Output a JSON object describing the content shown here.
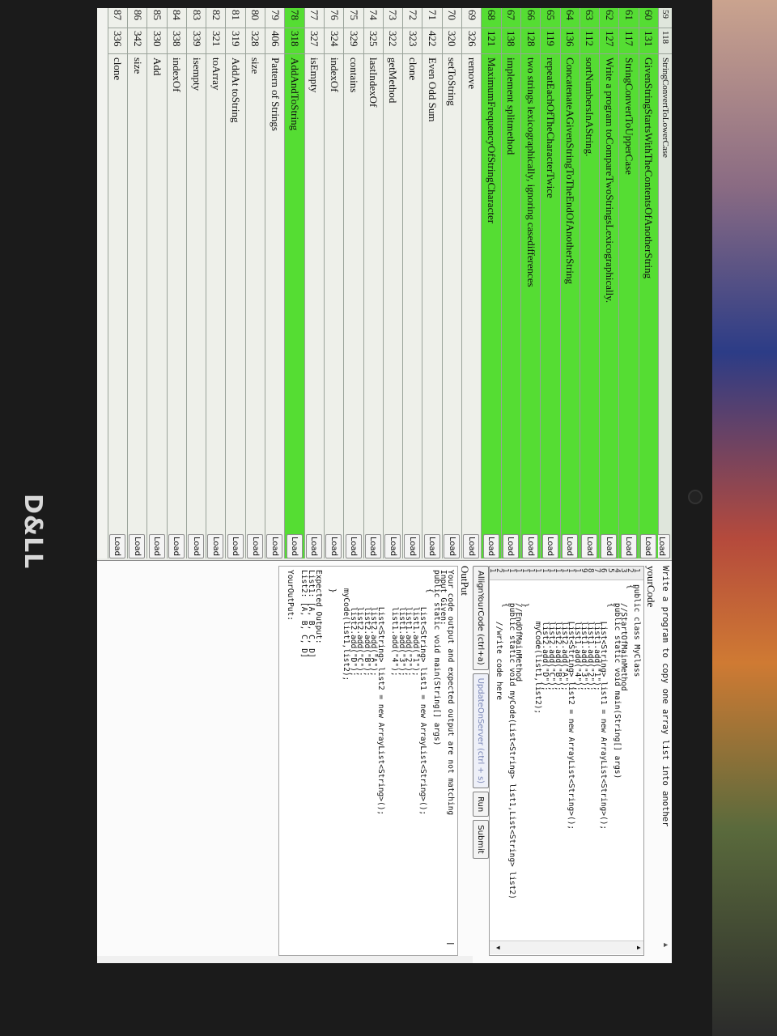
{
  "device": {
    "brand": "D&LL"
  },
  "problems": {
    "header_partial": "StringConvertToLowerCase",
    "header_no": "59",
    "header_id": "118",
    "load_label": "Load",
    "rows": [
      {
        "no": "60",
        "id": "131",
        "name": "GivenStringStartsWithTheContentsOfAnotherString",
        "status": "done"
      },
      {
        "no": "61",
        "id": "117",
        "name": "StringConvertToUpperCase",
        "status": "done"
      },
      {
        "no": "62",
        "id": "127",
        "name": "Write a program toCompareTwoStringsLexicographically.",
        "status": "done"
      },
      {
        "no": "63",
        "id": "112",
        "name": "sortNumbersInAString.",
        "status": "done"
      },
      {
        "no": "64",
        "id": "136",
        "name": "ConcatenateAGivenStringToTheEndOfAnotherString",
        "status": "done"
      },
      {
        "no": "65",
        "id": "119",
        "name": "repeatEachOfTheCharacterTwice",
        "status": "done"
      },
      {
        "no": "66",
        "id": "128",
        "name": "two strings lexicographically, ignoring casedifferences",
        "status": "done"
      },
      {
        "no": "67",
        "id": "138",
        "name": "implement splitmethod",
        "status": "done"
      },
      {
        "no": "68",
        "id": "121",
        "name": "MaximumFrequencyOfStringCharacter",
        "status": "done"
      },
      {
        "no": "69",
        "id": "326",
        "name": "remove",
        "status": "plain"
      },
      {
        "no": "70",
        "id": "320",
        "name": "setToString",
        "status": "plain"
      },
      {
        "no": "71",
        "id": "422",
        "name": "Even Odd Sum",
        "status": "plain"
      },
      {
        "no": "72",
        "id": "323",
        "name": "clone",
        "status": "plain"
      },
      {
        "no": "73",
        "id": "322",
        "name": "getMethod",
        "status": "plain"
      },
      {
        "no": "74",
        "id": "325",
        "name": "lastIndexOf",
        "status": "plain"
      },
      {
        "no": "75",
        "id": "329",
        "name": "contains",
        "status": "plain"
      },
      {
        "no": "76",
        "id": "324",
        "name": "indexOf",
        "status": "plain"
      },
      {
        "no": "77",
        "id": "327",
        "name": "isEmpty",
        "status": "plain"
      },
      {
        "no": "78",
        "id": "318",
        "name": "AddAndToString",
        "status": "done"
      },
      {
        "no": "79",
        "id": "406",
        "name": "Pattern of Strings",
        "status": "plain"
      },
      {
        "no": "80",
        "id": "328",
        "name": "size",
        "status": "plain"
      },
      {
        "no": "81",
        "id": "319",
        "name": "AddAt toString",
        "status": "plain"
      },
      {
        "no": "82",
        "id": "321",
        "name": "toArray",
        "status": "plain"
      },
      {
        "no": "83",
        "id": "339",
        "name": "isempty",
        "status": "plain"
      },
      {
        "no": "84",
        "id": "338",
        "name": "indexOf",
        "status": "plain"
      },
      {
        "no": "85",
        "id": "330",
        "name": "Add",
        "status": "plain"
      },
      {
        "no": "86",
        "id": "342",
        "name": "size",
        "status": "plain"
      },
      {
        "no": "87",
        "id": "336",
        "name": "clone",
        "status": "plain"
      }
    ]
  },
  "problem_title": "Write a program to copy one array list into another",
  "your_code_label": "yourCode",
  "editor": {
    "gutter": [
      "1",
      "2",
      "3",
      "4",
      "5",
      "6",
      "7",
      "8",
      "9",
      "1",
      "1",
      "1",
      "1",
      "1",
      "1",
      "1",
      "1",
      "1",
      "1",
      "1",
      "1",
      "2",
      "1"
    ],
    "lines": [
      "public class MyClass",
      "{",
      "    //StartOfMainMethod",
      "    public static void main(String[] args)",
      "    {",
      "        List<String> list1 = new ArrayList<String>();",
      "        list1.add(\"1\");",
      "        list1.add(\"2\");",
      "        list1.add(\"3\");",
      "        list1.add(\"4\");",
      "        List<String> list2 = new ArrayList<String>();",
      "        list2.add(\"A\");",
      "        list2.add(\"B\");",
      "        list2.add(\"C\");",
      "        list2.add(\"D\");",
      "        myCode(list1,list2);",
      "",
      "    }",
      "    //EndOfMainMethod",
      "    public static void myCode(List<String> list1,List<String> list2)",
      "    {",
      "        //write code here",
      ""
    ]
  },
  "actions": {
    "align": "AllignYourCode (ctrl+a)",
    "update": "UpdateOnServer (ctrl + s)",
    "run": "Run",
    "submit": "Submit"
  },
  "output_label": "OutPut",
  "output_lines": [
    "Your code output and expected output are not matching",
    "Input Given:",
    "public static void main(String[] args)",
    "    {",
    "        List<String> list1 = new ArrayList<String>();",
    "        list1.add(\"1\");",
    "        list1.add(\"2\");",
    "        list1.add(\"3\");",
    "        list1.add(\"4\");",
    "",
    "        List<String> list2 = new ArrayList<String>();",
    "        list2.add(\"A\");",
    "        list2.add(\"B\");",
    "        list2.add(\"C\");",
    "        list2.add(\"D\");",
    "    myCode(list1,list2);",
    "",
    "    }",
    "",
    "Expected Output:",
    "List1: [A, B, C, D]",
    "List2: [A, B, C, D]",
    "",
    "YourOutPut:"
  ]
}
